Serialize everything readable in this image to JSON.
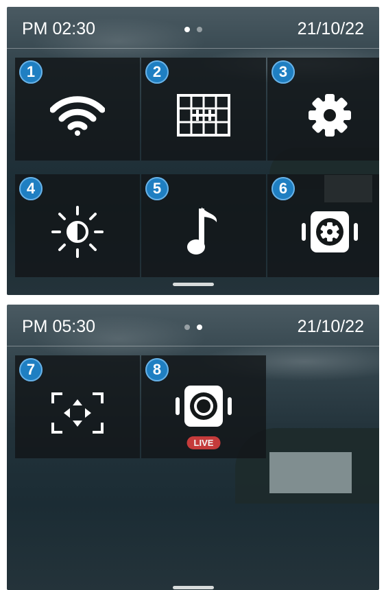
{
  "screen1": {
    "time": "PM 02:30",
    "date": "21/10/22",
    "page_dots": [
      "inactive-active",
      "inactive"
    ],
    "tiles": [
      {
        "number": "1",
        "icon": "wifi-icon"
      },
      {
        "number": "2",
        "icon": "grid-layout-icon"
      },
      {
        "number": "3",
        "icon": "gear-icon"
      },
      {
        "number": "4",
        "icon": "brightness-icon"
      },
      {
        "number": "5",
        "icon": "music-note-icon"
      },
      {
        "number": "6",
        "icon": "camera-settings-icon"
      }
    ]
  },
  "screen2": {
    "time": "PM 05:30",
    "date": "21/10/22",
    "tiles": [
      {
        "number": "7",
        "icon": "focus-adjust-icon"
      },
      {
        "number": "8",
        "icon": "live-camera-icon",
        "badge": "LIVE"
      }
    ]
  },
  "colors": {
    "badge": "#1f7fc2",
    "live": "#c53b3b",
    "tile": "#121618"
  }
}
